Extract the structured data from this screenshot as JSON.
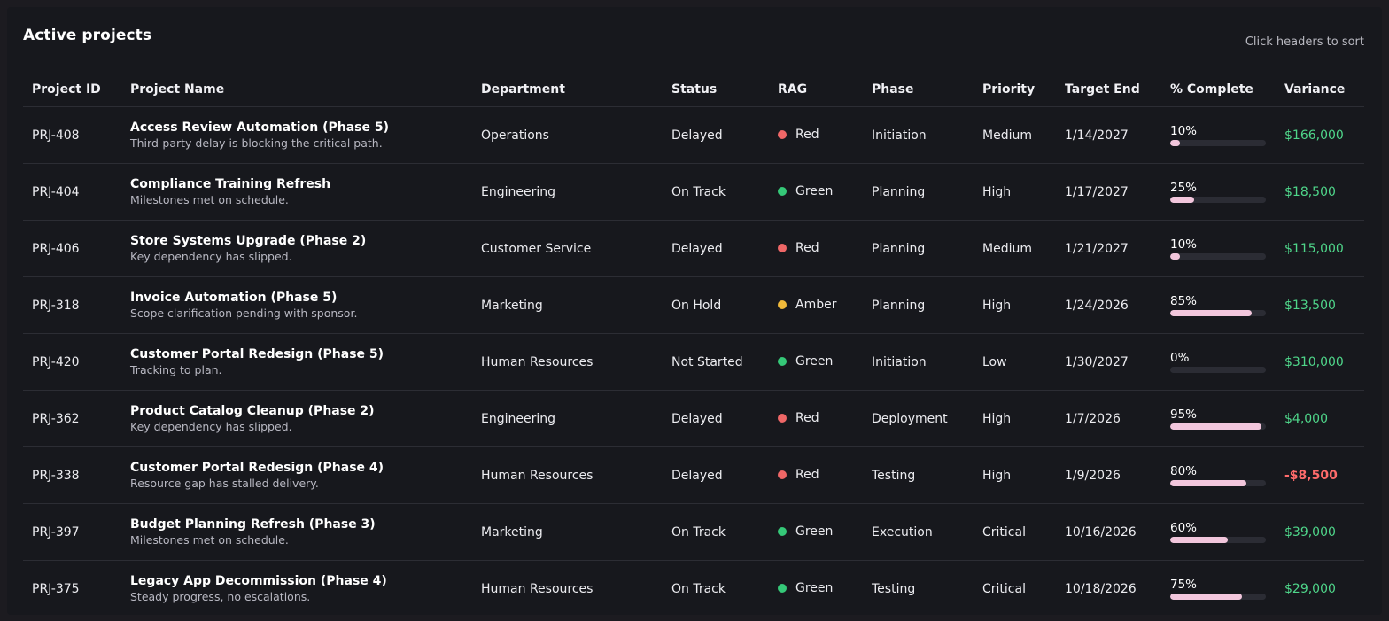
{
  "header": {
    "title": "Active projects",
    "sort_hint": "Click headers to sort"
  },
  "colors": {
    "Red": "#ef6767",
    "Green": "#35c878",
    "Amber": "#f0b93a",
    "progress_fill": "#f2c6dc",
    "variance_positive": "#4fd68a",
    "variance_negative": "#ff6b6b"
  },
  "columns": [
    {
      "key": "id",
      "label": "Project ID"
    },
    {
      "key": "name",
      "label": "Project Name"
    },
    {
      "key": "department",
      "label": "Department"
    },
    {
      "key": "status",
      "label": "Status"
    },
    {
      "key": "rag",
      "label": "RAG"
    },
    {
      "key": "phase",
      "label": "Phase"
    },
    {
      "key": "priority",
      "label": "Priority"
    },
    {
      "key": "target_end",
      "label": "Target End"
    },
    {
      "key": "complete",
      "label": "% Complete"
    },
    {
      "key": "variance",
      "label": "Variance"
    }
  ],
  "rows": [
    {
      "id": "PRJ-408",
      "name": "Access Review Automation (Phase 5)",
      "note": "Third-party delay is blocking the critical path.",
      "department": "Operations",
      "status": "Delayed",
      "rag": "Red",
      "phase": "Initiation",
      "priority": "Medium",
      "target_end": "1/14/2027",
      "complete": 10,
      "complete_label": "10%",
      "variance": "$166,000",
      "variance_sign": "positive"
    },
    {
      "id": "PRJ-404",
      "name": "Compliance Training Refresh",
      "note": "Milestones met on schedule.",
      "department": "Engineering",
      "status": "On Track",
      "rag": "Green",
      "phase": "Planning",
      "priority": "High",
      "target_end": "1/17/2027",
      "complete": 25,
      "complete_label": "25%",
      "variance": "$18,500",
      "variance_sign": "positive"
    },
    {
      "id": "PRJ-406",
      "name": "Store Systems Upgrade (Phase 2)",
      "note": "Key dependency has slipped.",
      "department": "Customer Service",
      "status": "Delayed",
      "rag": "Red",
      "phase": "Planning",
      "priority": "Medium",
      "target_end": "1/21/2027",
      "complete": 10,
      "complete_label": "10%",
      "variance": "$115,000",
      "variance_sign": "positive"
    },
    {
      "id": "PRJ-318",
      "name": "Invoice Automation (Phase 5)",
      "note": "Scope clarification pending with sponsor.",
      "department": "Marketing",
      "status": "On Hold",
      "rag": "Amber",
      "phase": "Planning",
      "priority": "High",
      "target_end": "1/24/2026",
      "complete": 85,
      "complete_label": "85%",
      "variance": "$13,500",
      "variance_sign": "positive"
    },
    {
      "id": "PRJ-420",
      "name": "Customer Portal Redesign (Phase 5)",
      "note": "Tracking to plan.",
      "department": "Human Resources",
      "status": "Not Started",
      "rag": "Green",
      "phase": "Initiation",
      "priority": "Low",
      "target_end": "1/30/2027",
      "complete": 0,
      "complete_label": "0%",
      "variance": "$310,000",
      "variance_sign": "positive"
    },
    {
      "id": "PRJ-362",
      "name": "Product Catalog Cleanup (Phase 2)",
      "note": "Key dependency has slipped.",
      "department": "Engineering",
      "status": "Delayed",
      "rag": "Red",
      "phase": "Deployment",
      "priority": "High",
      "target_end": "1/7/2026",
      "complete": 95,
      "complete_label": "95%",
      "variance": "$4,000",
      "variance_sign": "positive"
    },
    {
      "id": "PRJ-338",
      "name": "Customer Portal Redesign (Phase 4)",
      "note": "Resource gap has stalled delivery.",
      "department": "Human Resources",
      "status": "Delayed",
      "rag": "Red",
      "phase": "Testing",
      "priority": "High",
      "target_end": "1/9/2026",
      "complete": 80,
      "complete_label": "80%",
      "variance": "-$8,500",
      "variance_sign": "negative"
    },
    {
      "id": "PRJ-397",
      "name": "Budget Planning Refresh (Phase 3)",
      "note": "Milestones met on schedule.",
      "department": "Marketing",
      "status": "On Track",
      "rag": "Green",
      "phase": "Execution",
      "priority": "Critical",
      "target_end": "10/16/2026",
      "complete": 60,
      "complete_label": "60%",
      "variance": "$39,000",
      "variance_sign": "positive"
    },
    {
      "id": "PRJ-375",
      "name": "Legacy App Decommission (Phase 4)",
      "note": "Steady progress, no escalations.",
      "department": "Human Resources",
      "status": "On Track",
      "rag": "Green",
      "phase": "Testing",
      "priority": "Critical",
      "target_end": "10/18/2026",
      "complete": 75,
      "complete_label": "75%",
      "variance": "$29,000",
      "variance_sign": "positive"
    }
  ]
}
